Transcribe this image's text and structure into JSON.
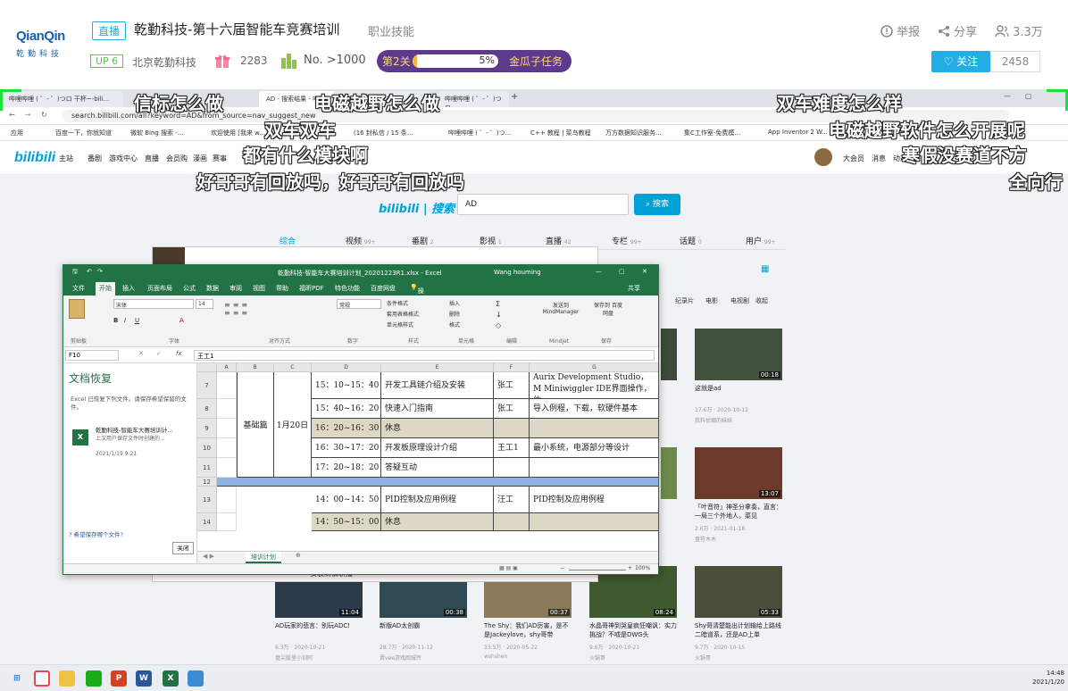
{
  "header": {
    "logo_line1": "QianQin",
    "logo_line2": "乾勤科技",
    "live_tag": "直播",
    "title": "乾勤科技-第十六届智能车竞赛培训",
    "category": "职业技能",
    "up_level": "UP 6",
    "up_name": "北京乾勤科技",
    "gift_count": "2283",
    "rank": "No. >1000",
    "task_level": "第2关",
    "task_percent": "5%",
    "task_progress": 0.05,
    "task_label": "金瓜子任务",
    "report": "举报",
    "share": "分享",
    "viewers": "3.3万",
    "follow_label": "关注",
    "follow_count": "2458"
  },
  "browser": {
    "tabs": [
      "哔哩哔哩 ( ゜- ゜)つロ 干杯~-bili...",
      "AD - 搜索结果 - 哔哩...",
      "(16 封私信 / 15 条...",
      "哔哩哔哩 ( ゜- ゜)つロ..."
    ],
    "url": "search.bilibili.com/all?keyword=AD&from_source=nav_suggest_new",
    "bookmarks": [
      "应用",
      "百度一下，你就知道",
      "微软 Bing 搜索 -...",
      "欢迎使用 [我来 w...",
      "(16 封私信 / 15 条...",
      "哔哩哔哩 ( ゜- ゜)つ...",
      "C++ 教程 | 菜鸟教程",
      "万方数据知识服务...",
      "集C工作室-免费模...",
      "App Inventor 2 W..."
    ],
    "bili_logo": "bilibili",
    "nav": [
      "主站",
      "番剧",
      "游戏中心",
      "直播",
      "会员购",
      "漫画",
      "赛事"
    ],
    "nav_right": [
      "大会员",
      "消息",
      "动态"
    ]
  },
  "search": {
    "logo": "bilibili | 搜索",
    "query": "AD",
    "button": "搜索",
    "tabs": [
      {
        "label": "综合",
        "count": ""
      },
      {
        "label": "视频",
        "count": "99+"
      },
      {
        "label": "番剧",
        "count": "2"
      },
      {
        "label": "影视",
        "count": "1"
      },
      {
        "label": "直播",
        "count": "42"
      },
      {
        "label": "专栏",
        "count": "99+"
      },
      {
        "label": "话题",
        "count": "0"
      },
      {
        "label": "用户",
        "count": "99+"
      }
    ],
    "filters": [
      "纪录片",
      "电影",
      "电视剧",
      "收起"
    ]
  },
  "videos": [
    {
      "title": "这就是ad",
      "duration": "00:18",
      "views": "17.6万",
      "date": "2020-10-12",
      "author": "我料仗娜的妹妹"
    },
    {
      "title": "「叶音符」神圣分拿奏，直言：一局三个外地人，菜见",
      "duration": "13:07",
      "views": "2.6万",
      "date": "2021-01-18",
      "author": "盘符木木"
    },
    {
      "title": "AD玩家的悲言：别玩ADC!",
      "duration": "11:04",
      "views": "6.3万",
      "date": "2020-10-21",
      "author": "盘尖股里小训阿"
    },
    {
      "title": "新版AD太创霸",
      "duration": "00:38",
      "views": "28.7万",
      "date": "2020-11-12",
      "author": "晋vee游戏回城传"
    },
    {
      "title": "The Shy：我们AD厉害，是不是Jackeylove，shy哥带",
      "duration": "00:37",
      "views": "33.5万",
      "date": "2020-05-22",
      "author": "wshshen"
    },
    {
      "title": "水晶哥神到哭皇疯狂嘲讽：实力挑战？不嘘是DWG头",
      "duration": "08:24",
      "views": "9.6万",
      "date": "2020-10-21",
      "author": "火锅哥"
    },
    {
      "title": "Shy哥清楚能出计划输给上路线二暗道系，还是AD上单",
      "duration": "05:33",
      "views": "9.7万",
      "date": "2020-10-15",
      "author": "火锅哥"
    }
  ],
  "excel": {
    "title": "乾勤科技-智能车大赛培训计划_20201223R1.xlsx - Excel",
    "user": "Wang houming",
    "menu": [
      "文件",
      "开始",
      "插入",
      "页面布局",
      "公式",
      "数据",
      "审阅",
      "视图",
      "帮助",
      "福昕PDF",
      "特色功能",
      "百度网盘",
      "操作说明搜索",
      "共享"
    ],
    "ribbon_groups": [
      "剪贴板",
      "字体",
      "对齐方式",
      "数字",
      "样式",
      "单元格",
      "编辑",
      "Mindjet",
      "保存"
    ],
    "font_name": "宋体",
    "font_size": "14",
    "number_format": "常规",
    "style_buttons": [
      "条件格式",
      "套用表格格式",
      "单元格样式"
    ],
    "cell_buttons": [
      "插入",
      "删除",
      "格式"
    ],
    "mindjet_label": "发送到 MindManager",
    "save_label": "保存到 百度网盘",
    "name_box": "F10",
    "formula": "王工1",
    "recovery_title": "文档恢复",
    "recovery_desc": "Excel 已恢复下列文件。请保存希望保留的文件。",
    "recovery_file": "乾勤科技-智能车大赛培训计...",
    "recovery_file_desc": "上次用户保存文件时创建的...",
    "recovery_date": "2021/1/19 9:21",
    "recovery_help": "希望保存哪个文件?",
    "recovery_close": "关闭",
    "columns": [
      "A",
      "B",
      "C",
      "D",
      "E",
      "F",
      "G"
    ],
    "rows": [
      {
        "num": "7",
        "d": "15：10~15：40",
        "e": "开发工具链介绍及安装",
        "f": "张工",
        "g": "Aurix Development Studio，M Miniwiggler IDE界面操作，仿"
      },
      {
        "num": "8",
        "d": "15：40~16：20",
        "e": "快速入门指南",
        "f": "张工",
        "g": "导入例程，下载，软硬件基本"
      },
      {
        "num": "9",
        "d": "16：20~16：30",
        "e": "休息",
        "f": "",
        "g": ""
      },
      {
        "num": "10",
        "d": "16：30~17：20",
        "e": "开发板原理设计介绍",
        "f": "王工1",
        "g": "最小系统，电源部分等设计"
      },
      {
        "num": "11",
        "d": "17：20~18：20",
        "e": "答疑互动",
        "f": "",
        "g": ""
      },
      {
        "num": "12",
        "d": "",
        "e": "",
        "f": "",
        "g": ""
      },
      {
        "num": "13",
        "d": "14：00~14：50",
        "e": "PID控制及应用例程",
        "f": "汪工",
        "g": "PID控制及应用例程"
      },
      {
        "num": "14",
        "d": "14：50~15：00",
        "e": "休息",
        "f": "",
        "g": ""
      }
    ],
    "b_label": "基础篇",
    "c_label": "1月20日",
    "sheet_tab": "培训计划",
    "zoom": "100%"
  },
  "behind_window": {
    "item": "安装新旧联播"
  },
  "danmaku": [
    "信标怎么做",
    "电磁越野怎么做",
    "双车难度怎么样",
    "双车双车",
    "电磁越野软件怎么开展呢",
    "都有什么模块啊",
    "寒假没赛道不方",
    "好哥哥有回放吗，好哥哥有回放吗",
    "全向行"
  ],
  "taskbar": {
    "time": "14:48",
    "date": "2021/1/20"
  }
}
